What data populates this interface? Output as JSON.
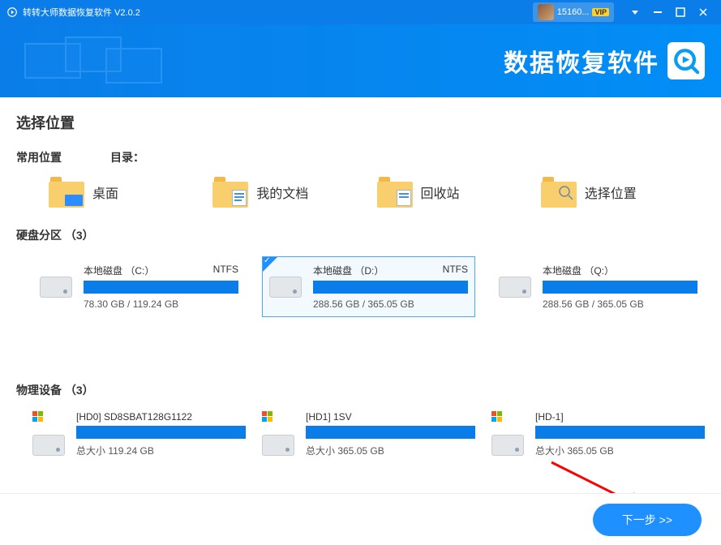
{
  "titlebar": {
    "app_title": "转转大师数据恢复软件 V2.0.2",
    "user_id": "15160...",
    "vip_label": "VIP"
  },
  "banner": {
    "title": "数据恢复软件"
  },
  "main": {
    "select_location": "选择位置",
    "common_locations_label": "常用位置",
    "directory_label": "目录：",
    "common_items": [
      {
        "label": "桌面"
      },
      {
        "label": "我的文档"
      },
      {
        "label": "回收站"
      },
      {
        "label": "选择位置"
      }
    ],
    "partitions_header": "硬盘分区 （3）",
    "partitions": [
      {
        "title": "本地磁盘 （C:）",
        "fs": "NTFS",
        "size": "78.30 GB / 119.24 GB",
        "selected": false
      },
      {
        "title": "本地磁盘 （D:）",
        "fs": "NTFS",
        "size": "288.56 GB / 365.05 GB",
        "selected": true
      },
      {
        "title": "本地磁盘 （Q:）",
        "fs": "",
        "size": "288.56 GB / 365.05 GB",
        "selected": false
      }
    ],
    "physical_header": "物理设备 （3）",
    "physical": [
      {
        "title": "[HD0] SD8SBAT128G1122",
        "size": "总大小 119.24 GB"
      },
      {
        "title": "[HD1] 1SV",
        "size": "总大小 365.05 GB"
      },
      {
        "title": "[HD-1]",
        "size": "总大小 365.05 GB"
      }
    ]
  },
  "footer": {
    "next_label": "下一步 >>"
  }
}
